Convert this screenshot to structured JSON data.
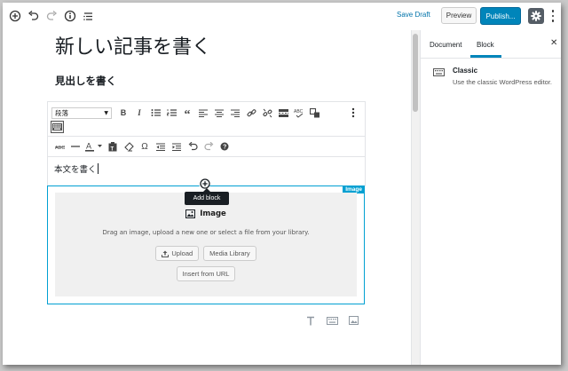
{
  "topbar": {
    "save_draft": "Save Draft",
    "preview": "Preview",
    "publish": "Publish..."
  },
  "editor": {
    "post_title": "新しい記事を書く",
    "heading": "見出しを書く",
    "classic": {
      "format_select": "段落",
      "body_text": "本文を書く"
    },
    "add_block_tooltip": "Add block",
    "image_block": {
      "label": "Image",
      "title": "Image",
      "instructions": "Drag an image, upload a new one or select a file from your library.",
      "upload": "Upload",
      "media_library": "Media Library",
      "insert_url": "Insert from URL"
    }
  },
  "sidebar": {
    "tabs": [
      "Document",
      "Block"
    ],
    "active_tab": "Block",
    "block_card": {
      "title": "Classic",
      "description": "Use the classic WordPress editor."
    }
  },
  "colors": {
    "accent": "#0085ba",
    "link": "#0073aa",
    "selection": "#00a0d2"
  }
}
